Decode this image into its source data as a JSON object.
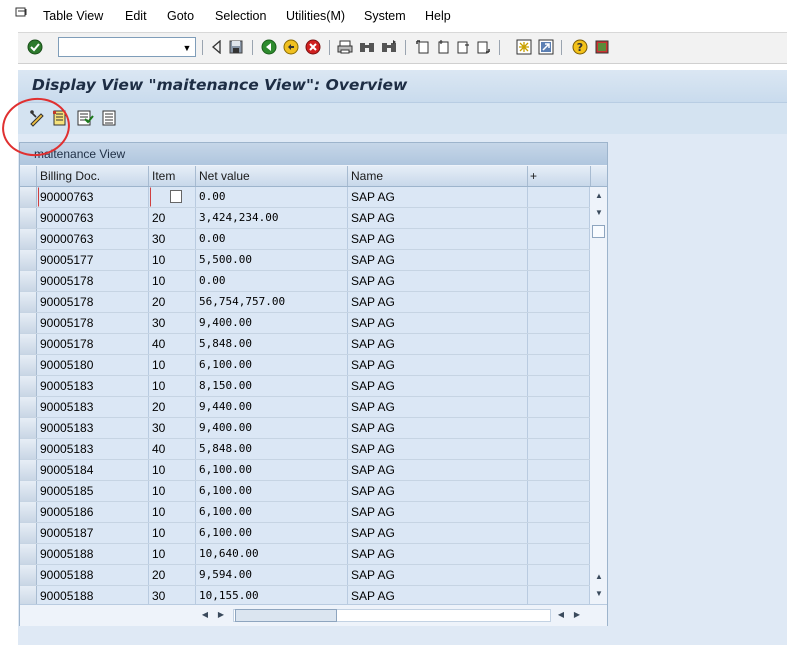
{
  "menubar": {
    "items": [
      "Table View",
      "Edit",
      "Goto",
      "Selection",
      "Utilities(M)",
      "System",
      "Help"
    ]
  },
  "toolbar": {
    "command_field_value": "",
    "icons": [
      "enter-icon",
      "back-icon",
      "save-icon",
      "green-back-icon",
      "exit-icon",
      "cancel-icon",
      "print-icon",
      "find-icon",
      "find-next-icon",
      "first-page-icon",
      "previous-page-icon",
      "next-page-icon",
      "last-page-icon",
      "create-session-icon",
      "shortcut-icon",
      "help-icon",
      "layout-icon"
    ]
  },
  "title": "Display View \"maitenance View\": Overview",
  "app_toolbar": {
    "icons": [
      "display-change-icon",
      "details-icon",
      "select-all-icon",
      "deselect-all-icon"
    ]
  },
  "table": {
    "title": "maitenance View",
    "columns": [
      "Billing Doc.",
      "Item",
      "Net value",
      "Name",
      "+"
    ],
    "rows": [
      [
        "90000763",
        "",
        "0.00",
        "SAP AG"
      ],
      [
        "90000763",
        "20",
        "3,424,234.00",
        "SAP AG"
      ],
      [
        "90000763",
        "30",
        "0.00",
        "SAP AG"
      ],
      [
        "90005177",
        "10",
        "5,500.00",
        "SAP AG"
      ],
      [
        "90005178",
        "10",
        "0.00",
        "SAP AG"
      ],
      [
        "90005178",
        "20",
        "56,754,757.00",
        "SAP AG"
      ],
      [
        "90005178",
        "30",
        "9,400.00",
        "SAP AG"
      ],
      [
        "90005178",
        "40",
        "5,848.00",
        "SAP AG"
      ],
      [
        "90005180",
        "10",
        "6,100.00",
        "SAP AG"
      ],
      [
        "90005183",
        "10",
        "8,150.00",
        "SAP AG"
      ],
      [
        "90005183",
        "20",
        "9,440.00",
        "SAP AG"
      ],
      [
        "90005183",
        "30",
        "9,400.00",
        "SAP AG"
      ],
      [
        "90005183",
        "40",
        "5,848.00",
        "SAP AG"
      ],
      [
        "90005184",
        "10",
        "6,100.00",
        "SAP AG"
      ],
      [
        "90005185",
        "10",
        "6,100.00",
        "SAP AG"
      ],
      [
        "90005186",
        "10",
        "6,100.00",
        "SAP AG"
      ],
      [
        "90005187",
        "10",
        "6,100.00",
        "SAP AG"
      ],
      [
        "90005188",
        "10",
        "10,640.00",
        "SAP AG"
      ],
      [
        "90005188",
        "20",
        "9,594.00",
        "SAP AG"
      ],
      [
        "90005188",
        "30",
        "10,155.00",
        "SAP AG"
      ]
    ]
  },
  "colors": {
    "annotation_circle": "#e03030",
    "title_text": "#1d2d44",
    "cell_background": "#dbe7f5"
  }
}
